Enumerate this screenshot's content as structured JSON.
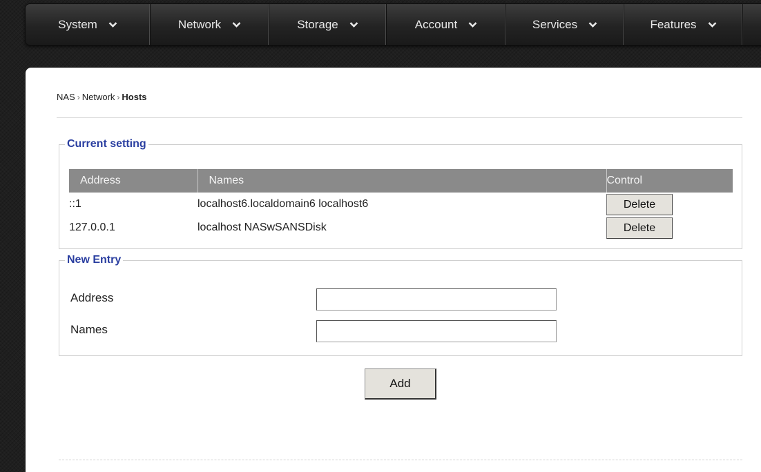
{
  "nav": {
    "items": [
      {
        "label": "System"
      },
      {
        "label": "Network"
      },
      {
        "label": "Storage"
      },
      {
        "label": "Account"
      },
      {
        "label": "Services"
      },
      {
        "label": "Features"
      }
    ]
  },
  "breadcrumb": {
    "items": [
      "NAS",
      "Network"
    ],
    "current": "Hosts",
    "separator": "›"
  },
  "current_setting": {
    "legend": "Current setting",
    "columns": [
      "Address",
      "Names",
      "Control"
    ],
    "rows": [
      {
        "address": "::1",
        "names": "localhost6.localdomain6 localhost6",
        "action": "Delete"
      },
      {
        "address": "127.0.0.1",
        "names": "localhost NASwSANSDisk",
        "action": "Delete"
      }
    ]
  },
  "new_entry": {
    "legend": "New Entry",
    "address_label": "Address",
    "address_value": "",
    "names_label": "Names",
    "names_value": ""
  },
  "add_button": "Add",
  "colors": {
    "legend": "#2a3ea0",
    "table_header_bg": "#8a8a8a",
    "navbar_bg": "#2b2b2b",
    "button_bg": "#e4e2dc"
  },
  "icons": {
    "nav_dropdown": "chevron-down-icon"
  }
}
